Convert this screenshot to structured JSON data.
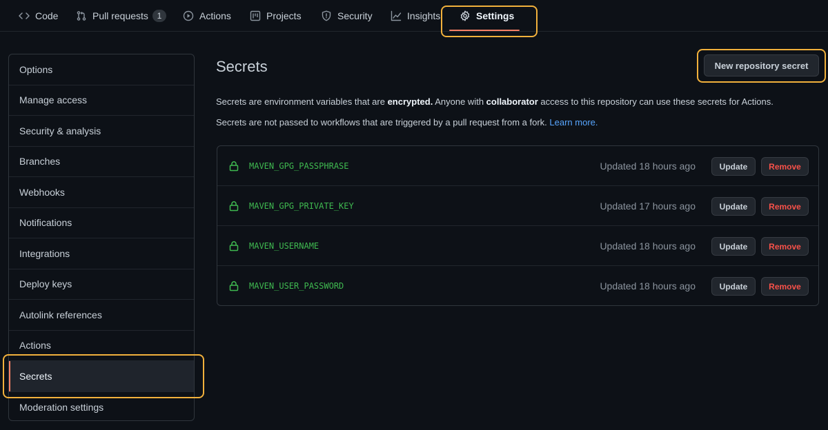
{
  "nav": {
    "tabs": [
      {
        "label": "Code",
        "icon": "code-icon"
      },
      {
        "label": "Pull requests",
        "icon": "git-pull-request-icon",
        "count": "1"
      },
      {
        "label": "Actions",
        "icon": "play-icon"
      },
      {
        "label": "Projects",
        "icon": "project-icon"
      },
      {
        "label": "Security",
        "icon": "shield-icon"
      },
      {
        "label": "Insights",
        "icon": "graph-icon"
      },
      {
        "label": "Settings",
        "icon": "gear-icon",
        "selected": true
      }
    ]
  },
  "sidebar": {
    "items": [
      {
        "label": "Options"
      },
      {
        "label": "Manage access"
      },
      {
        "label": "Security & analysis"
      },
      {
        "label": "Branches"
      },
      {
        "label": "Webhooks"
      },
      {
        "label": "Notifications"
      },
      {
        "label": "Integrations"
      },
      {
        "label": "Deploy keys"
      },
      {
        "label": "Autolink references"
      },
      {
        "label": "Actions"
      },
      {
        "label": "Secrets",
        "active": true
      },
      {
        "label": "Moderation settings"
      }
    ]
  },
  "main": {
    "title": "Secrets",
    "new_secret_button": "New repository secret",
    "description1": {
      "part1": "Secrets are environment variables that are ",
      "bold1": "encrypted.",
      "part2": " Anyone with ",
      "bold2": "collaborator",
      "part3": " access to this repository can use these secrets for Actions."
    },
    "description2": {
      "text": "Secrets are not passed to workflows that are triggered by a pull request from a fork. ",
      "link": "Learn more."
    },
    "secrets": [
      {
        "name": "MAVEN_GPG_PASSPHRASE",
        "updated": "Updated 18 hours ago"
      },
      {
        "name": "MAVEN_GPG_PRIVATE_KEY",
        "updated": "Updated 17 hours ago"
      },
      {
        "name": "MAVEN_USERNAME",
        "updated": "Updated 18 hours ago"
      },
      {
        "name": "MAVEN_USER_PASSWORD",
        "updated": "Updated 18 hours ago"
      }
    ],
    "update_label": "Update",
    "remove_label": "Remove"
  },
  "colors": {
    "background": "#0d1117",
    "border": "#30363d",
    "accent_underline": "#f78166",
    "highlight": "#f2b13c",
    "secret_green": "#3fb950",
    "danger": "#f85149",
    "link": "#58a6ff"
  }
}
